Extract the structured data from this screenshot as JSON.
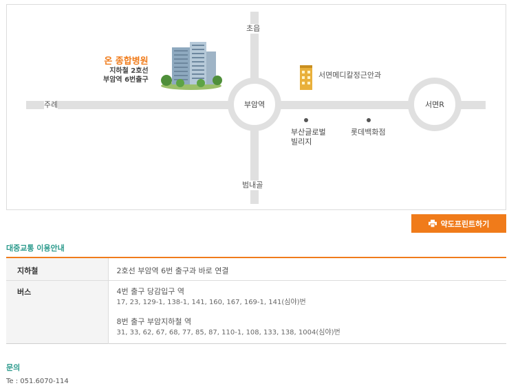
{
  "map": {
    "north_label": "초읍",
    "south_label": "범내골",
    "west_label": "주례",
    "center_node": "부암역",
    "east_node": "서면R",
    "hospital": {
      "name": "온 종합병원",
      "line1": "지하철 2호선",
      "line2": "부암역 6번출구"
    },
    "clinic_label": "서면메디칼정근안과",
    "landmark1_lines": [
      "부산글로벌",
      "빌리지"
    ],
    "landmark2_label": "롯데백화점"
  },
  "print_button": {
    "label": "약도프린트하기",
    "icon": "printer-icon"
  },
  "transit": {
    "title": "대중교통 이용안내",
    "subway": {
      "label": "지하철",
      "value": "2호선 부암역 6번 출구과 바로 연결"
    },
    "bus": {
      "label": "버스",
      "stops": [
        {
          "stop": "4번 출구 당감입구 역",
          "routes": "17, 23, 129-1, 138-1, 141, 160, 167, 169-1, 141(심야)번"
        },
        {
          "stop": "8번 출구 부암지하철 역",
          "routes": "31, 33, 62, 67, 68, 77, 85, 87, 110-1, 108, 133, 138, 1004(심야)번"
        }
      ]
    }
  },
  "contact": {
    "title": "문의",
    "tel": "Te : 051.6070-114"
  },
  "colors": {
    "accent": "#f07b1a",
    "section_title": "#2b9a8c",
    "road": "#e0e0e0"
  }
}
